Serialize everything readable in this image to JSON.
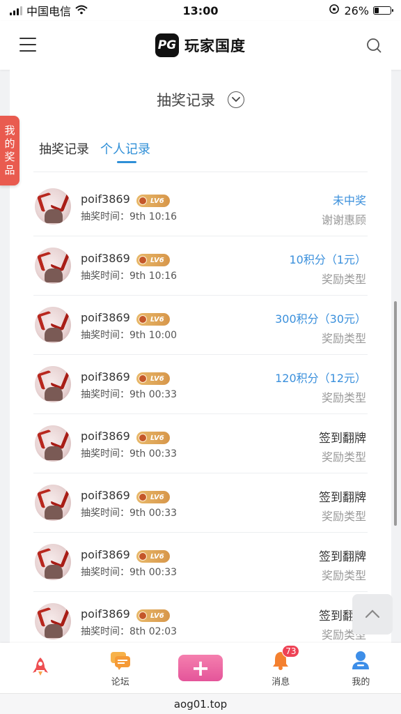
{
  "status_bar": {
    "carrier": "中国电信",
    "time": "13:00",
    "battery": "26%",
    "battery_level": 0.26
  },
  "header": {
    "logo_mark": "PG",
    "logo_text": "玩家国度",
    "menu_icon": "hamburger-menu-icon",
    "search_icon": "search-icon"
  },
  "side_tab": {
    "label": "我的奖品"
  },
  "card": {
    "title": "抽奖记录",
    "dropdown_icon": "chevron-down-icon",
    "tabs": [
      {
        "label": "抽奖记录",
        "active": false
      },
      {
        "label": "个人记录",
        "active": true
      }
    ]
  },
  "records": [
    {
      "username": "poif3869",
      "level": "LV6",
      "draw_time_label": "抽奖时间：",
      "draw_time": "9th 10:16",
      "result": "未中奖",
      "result_style": "blue",
      "type": "谢谢惠顾"
    },
    {
      "username": "poif3869",
      "level": "LV6",
      "draw_time_label": "抽奖时间：",
      "draw_time": "9th 10:16",
      "result": "10积分（1元）",
      "result_style": "blue",
      "type": "奖励类型"
    },
    {
      "username": "poif3869",
      "level": "LV6",
      "draw_time_label": "抽奖时间：",
      "draw_time": "9th 10:00",
      "result": "300积分（30元）",
      "result_style": "blue",
      "type": "奖励类型"
    },
    {
      "username": "poif3869",
      "level": "LV6",
      "draw_time_label": "抽奖时间：",
      "draw_time": "9th 00:33",
      "result": "120积分（12元）",
      "result_style": "blue",
      "type": "奖励类型"
    },
    {
      "username": "poif3869",
      "level": "LV6",
      "draw_time_label": "抽奖时间：",
      "draw_time": "9th 00:33",
      "result": "签到翻牌",
      "result_style": "dark",
      "type": "奖励类型"
    },
    {
      "username": "poif3869",
      "level": "LV6",
      "draw_time_label": "抽奖时间：",
      "draw_time": "9th 00:33",
      "result": "签到翻牌",
      "result_style": "dark",
      "type": "奖励类型"
    },
    {
      "username": "poif3869",
      "level": "LV6",
      "draw_time_label": "抽奖时间：",
      "draw_time": "9th 00:33",
      "result": "签到翻牌",
      "result_style": "dark",
      "type": "奖励类型"
    },
    {
      "username": "poif3869",
      "level": "LV6",
      "draw_time_label": "抽奖时间：",
      "draw_time": "8th 02:03",
      "result": "签到翻牌",
      "result_style": "dark",
      "type": "奖励类型"
    }
  ],
  "back_to_top_icon": "chevron-up-icon",
  "bottom_nav": {
    "items": [
      {
        "label": "",
        "icon": "rocket-icon"
      },
      {
        "label": "论坛",
        "icon": "chat-bubbles-icon"
      },
      {
        "label": "",
        "icon": "plus-icon",
        "center_symbol": "+"
      },
      {
        "label": "消息",
        "icon": "bell-icon",
        "badge": "73"
      },
      {
        "label": "我的",
        "icon": "user-icon"
      }
    ]
  },
  "url_bar": {
    "url": "aog01.top"
  },
  "colors": {
    "accent_blue": "#3b90dc",
    "side_tab_red": "#e95b4f",
    "center_button_pink": "#e4559a",
    "badge_red": "#ee4255"
  }
}
